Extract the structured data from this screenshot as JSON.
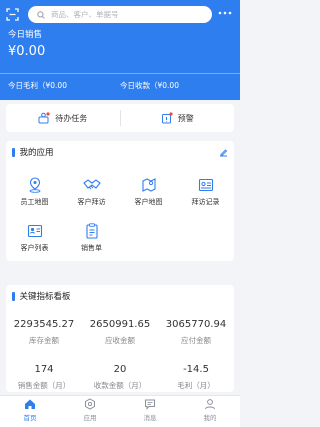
{
  "header": {
    "search_placeholder": "商品、客户、单据号",
    "today_sales_label": "今日销售",
    "today_sales_value": "¥0.00",
    "today_profit": "今日毛利（¥0.00",
    "today_receipt": "今日收款（¥0.00"
  },
  "quick": {
    "todo_label": "待办任务",
    "alert_label": "预警"
  },
  "apps": {
    "title": "我的应用",
    "items": [
      {
        "label": "员工地图",
        "icon": "map-pin-icon"
      },
      {
        "label": "客户拜访",
        "icon": "handshake-icon"
      },
      {
        "label": "客户地图",
        "icon": "customer-map-icon"
      },
      {
        "label": "拜访记录",
        "icon": "visit-record-icon"
      },
      {
        "label": "客户列表",
        "icon": "customer-list-icon"
      },
      {
        "label": "销售单",
        "icon": "sales-order-icon"
      }
    ]
  },
  "kpi": {
    "title": "关键指标看板",
    "items": [
      {
        "value": "2293545.27",
        "label": "库存金额"
      },
      {
        "value": "2650991.65",
        "label": "应收金额"
      },
      {
        "value": "3065770.94",
        "label": "应付金额"
      },
      {
        "value": "174",
        "label": "销售金额（月）"
      },
      {
        "value": "20",
        "label": "收款金额（月）"
      },
      {
        "value": "-14.5",
        "label": "毛利（月）"
      }
    ]
  },
  "tabs": [
    {
      "label": "首页",
      "icon": "home-icon",
      "active": true
    },
    {
      "label": "应用",
      "icon": "apps-icon",
      "active": false
    },
    {
      "label": "消息",
      "icon": "message-icon",
      "active": false
    },
    {
      "label": "我的",
      "icon": "user-icon",
      "active": false
    }
  ],
  "colors": {
    "accent": "#2f7ef0",
    "badge": "#f04b3a"
  }
}
